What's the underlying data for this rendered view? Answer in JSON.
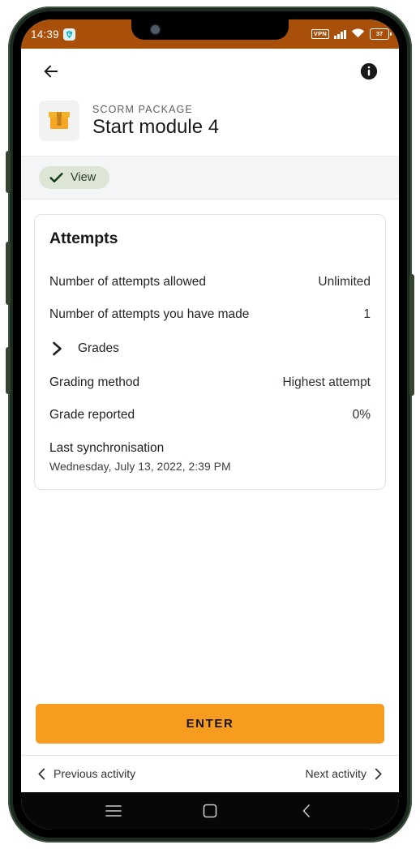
{
  "status_bar": {
    "clock": "14:39",
    "vpn_label": "VPN",
    "battery_level": "37",
    "app_icon": "vpn-shield-icon",
    "signal_icon": "cellular-signal-icon",
    "wifi_icon": "wifi-icon"
  },
  "app_bar": {
    "back_icon": "arrow-left-icon",
    "info_icon": "info-circle-icon"
  },
  "module": {
    "icon": "package-box-icon",
    "kicker": "SCORM PACKAGE",
    "title": "Start module 4"
  },
  "completion": {
    "chip_label": "View",
    "chip_icon": "check-icon"
  },
  "attempts_card": {
    "title": "Attempts",
    "rows": [
      {
        "label": "Number of attempts allowed",
        "value": "Unlimited"
      },
      {
        "label": "Number of attempts you have made",
        "value": "1"
      }
    ],
    "grades": {
      "label": "Grades",
      "icon": "chevron-right-icon"
    },
    "grade_rows": [
      {
        "label": "Grading method",
        "value": "Highest attempt"
      },
      {
        "label": "Grade reported",
        "value": "0%"
      }
    ],
    "sync": {
      "title": "Last synchronisation",
      "value": "Wednesday, July 13, 2022, 2:39 PM"
    }
  },
  "footer": {
    "enter_label": "ENTER",
    "previous_label": "Previous activity",
    "next_label": "Next activity",
    "previous_icon": "chevron-left-icon",
    "next_icon": "chevron-right-icon"
  },
  "android_nav": {
    "recents_icon": "menu-icon",
    "home_icon": "square-home-icon",
    "back_icon": "chevron-back-icon"
  },
  "colors": {
    "status_bar": "#a8500a",
    "accent_button": "#f79c1e",
    "chip_background": "#dde6d5",
    "chip_check": "#1e4620",
    "frame": "#1d2a1f"
  }
}
